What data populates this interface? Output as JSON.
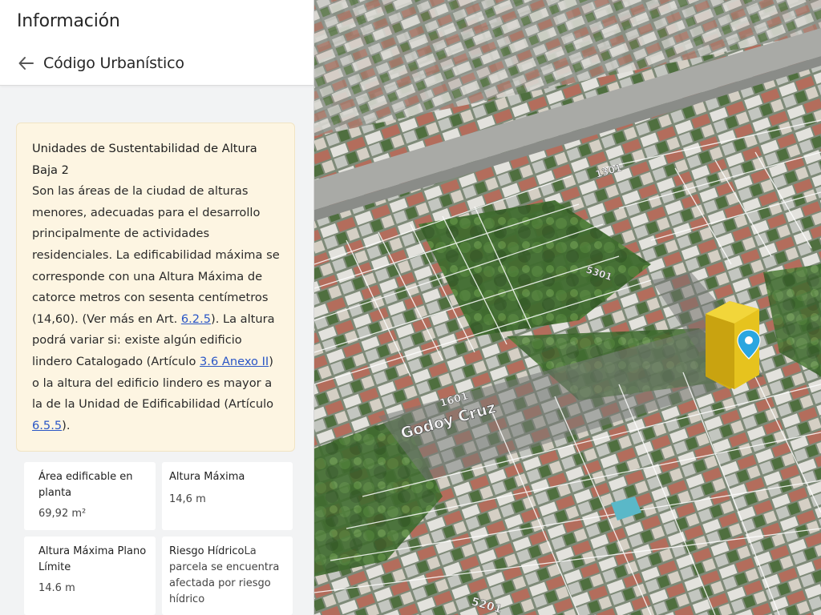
{
  "panel": {
    "title": "Información",
    "back_label": "Código Urbanístico"
  },
  "card": {
    "title": "Unidades de Sustentabilidad de Altura Baja 2",
    "text_1": "Son las áreas de la ciudad de alturas menores, adecuadas para el desarrollo principalmente de actividades residenciales. La edificabilidad máxima se corresponde con una Altura Máxima de catorce metros con sesenta centímetros (14,60). (Ver más en Art. ",
    "link_1": "6.2.5",
    "text_2": "). La altura podrá variar si: existe algún edificio lindero Catalogado (Artículo ",
    "link_2": "3.6 Anexo II",
    "text_3": ") o la altura del edificio lindero es mayor a la de la Unidad de Edificabilidad (Artículo ",
    "link_3": "6.5.5",
    "text_4": ")."
  },
  "stats": [
    {
      "label": "Área edificable en planta",
      "value": "69,92 m²"
    },
    {
      "label": "Altura Máxima",
      "value": "14,6 m"
    },
    {
      "label": "Altura Máxima Plano Límite",
      "value": "14.6 m"
    },
    {
      "label": "Riesgo Hídrico",
      "value": "La parcela se encuentra afectada por riesgo hídrico"
    }
  ],
  "map": {
    "street_label": "Godoy Cruz",
    "number_labels": [
      "1601",
      "5301",
      "1301",
      "5201"
    ],
    "colors": {
      "parcel_lines": "#ffffff",
      "building_volume": "#e6c31e",
      "marker": "#2aa6e0",
      "link": "#2a56c6"
    }
  }
}
